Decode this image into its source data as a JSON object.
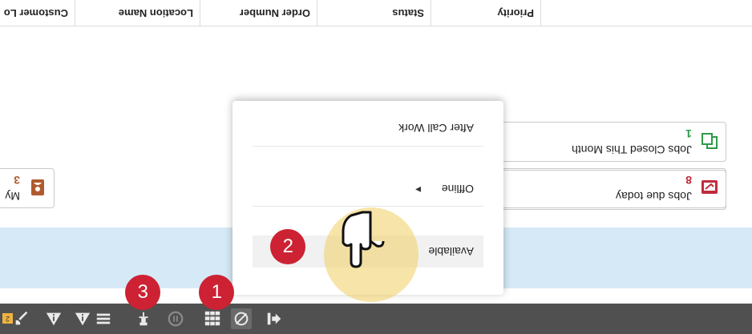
{
  "table_header": {
    "columns": [
      "Priority",
      "Status",
      "Order Number",
      "Location Name",
      "Customer Lo"
    ]
  },
  "cards": [
    {
      "title": "Jobs Closed This Month",
      "count": "1",
      "icon": "copy-documents-icon",
      "color": "#2e9a48"
    },
    {
      "title": "Jobs due today",
      "count": "8",
      "icon": "calendar-check-icon",
      "color": "#c02b3c"
    },
    {
      "title": "My",
      "count": "3",
      "icon": "address-book-icon",
      "color": "#b05a2e"
    },
    {
      "title": "",
      "count": ""
    }
  ],
  "status_menu": {
    "items": [
      {
        "label": "Available",
        "selected": true
      },
      {
        "label": "Offline",
        "has_submenu": true
      },
      {
        "label": "After Call Work"
      }
    ]
  },
  "markers": [
    "1",
    "2",
    "3"
  ],
  "taskbar": {
    "icons": [
      "logout-icon",
      "status-icon",
      "apps-grid-icon",
      "pause-icon",
      "push-pin-icon",
      "list-icon",
      "alert-icon",
      "warning-icon",
      "tools-icon"
    ],
    "badge": "2"
  },
  "colors": {
    "taskbar": "#505050",
    "marker": "#cc2233",
    "highlight_strip": "#d6e9f6"
  }
}
